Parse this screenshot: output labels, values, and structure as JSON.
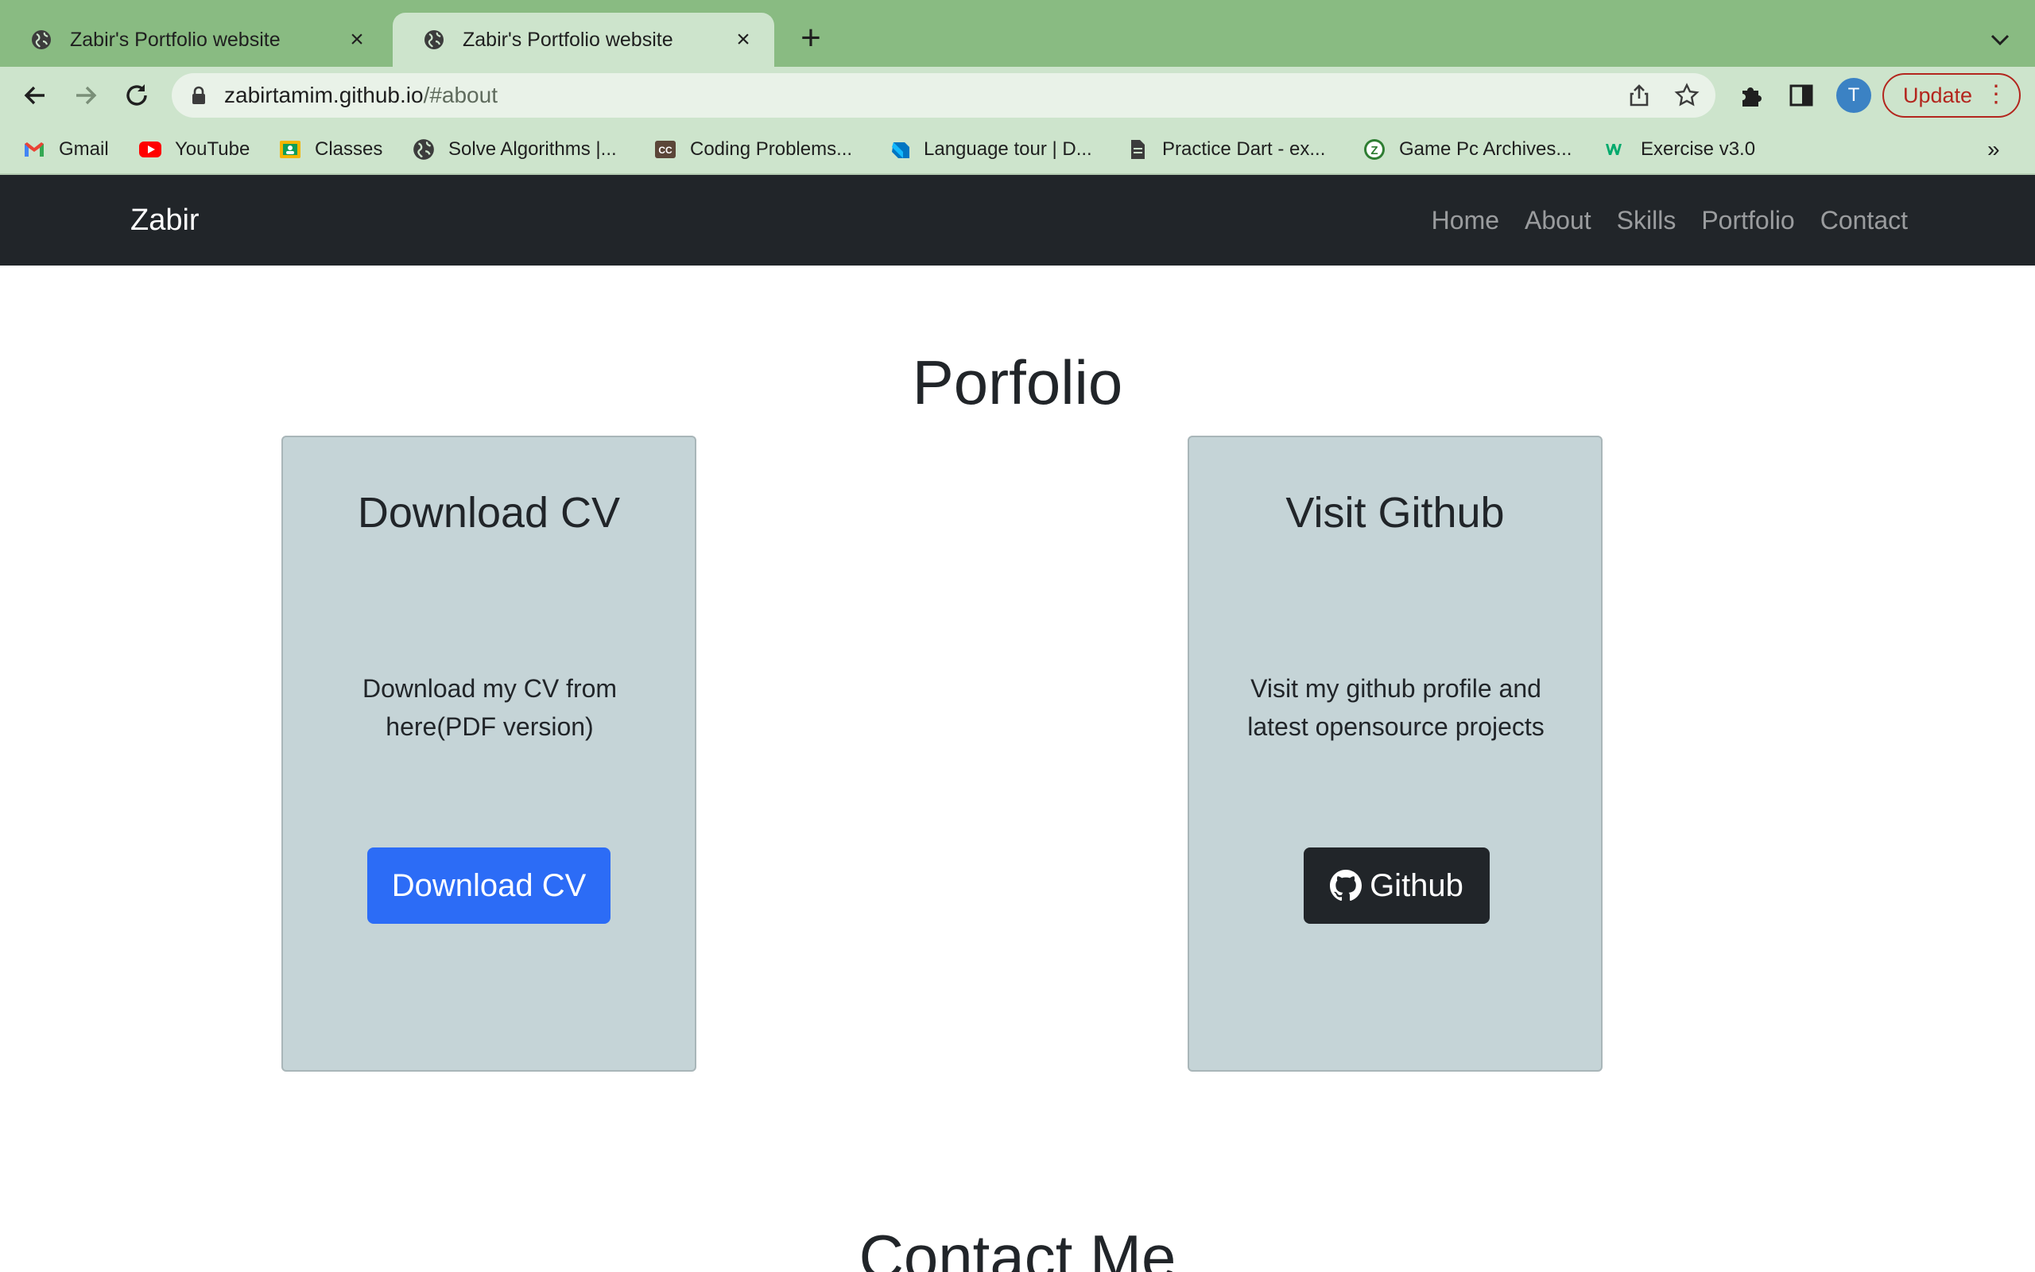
{
  "browser": {
    "tabs": [
      {
        "title": "Zabir's Portfolio website",
        "active": false
      },
      {
        "title": "Zabir's Portfolio website",
        "active": true
      }
    ],
    "url_host": "zabirtamim.github.io",
    "url_path": "/#about",
    "profile_initial": "T",
    "update_label": "Update",
    "update_menu": "⋮",
    "more_bookmarks": "»",
    "bookmarks": [
      {
        "label": "Gmail",
        "icon": "gmail-icon"
      },
      {
        "label": "YouTube",
        "icon": "youtube-icon"
      },
      {
        "label": "Classes",
        "icon": "classes-icon"
      },
      {
        "label": "Solve Algorithms |...",
        "icon": "globe-icon"
      },
      {
        "label": "Coding Problems...",
        "icon": "codechef-icon"
      },
      {
        "label": "Language tour | D...",
        "icon": "dart-icon"
      },
      {
        "label": "Practice Dart - ex...",
        "icon": "document-icon"
      },
      {
        "label": "Game Pc Archives...",
        "icon": "game-icon"
      },
      {
        "label": "Exercise v3.0",
        "icon": "w3schools-icon"
      }
    ]
  },
  "navbar": {
    "brand": "Zabir",
    "links": [
      "Home",
      "About",
      "Skills",
      "Portfolio",
      "Contact"
    ]
  },
  "portfolio": {
    "title": "Porfolio",
    "cards": [
      {
        "title": "Download CV",
        "text": "Download my CV from here(PDF version)",
        "button": "Download CV",
        "button_color": "#2c6cf6"
      },
      {
        "title": "Visit Github",
        "text": "Visit my github profile and latest opensource projects",
        "button": "Github",
        "button_icon": "github-icon",
        "button_color": "#212529"
      }
    ]
  },
  "contact": {
    "title": "Contact Me"
  },
  "colors": {
    "tabstrip": "#89bb82",
    "toolbar": "#cde4cc",
    "navbar": "#212529",
    "card": "#c5d4d7"
  }
}
